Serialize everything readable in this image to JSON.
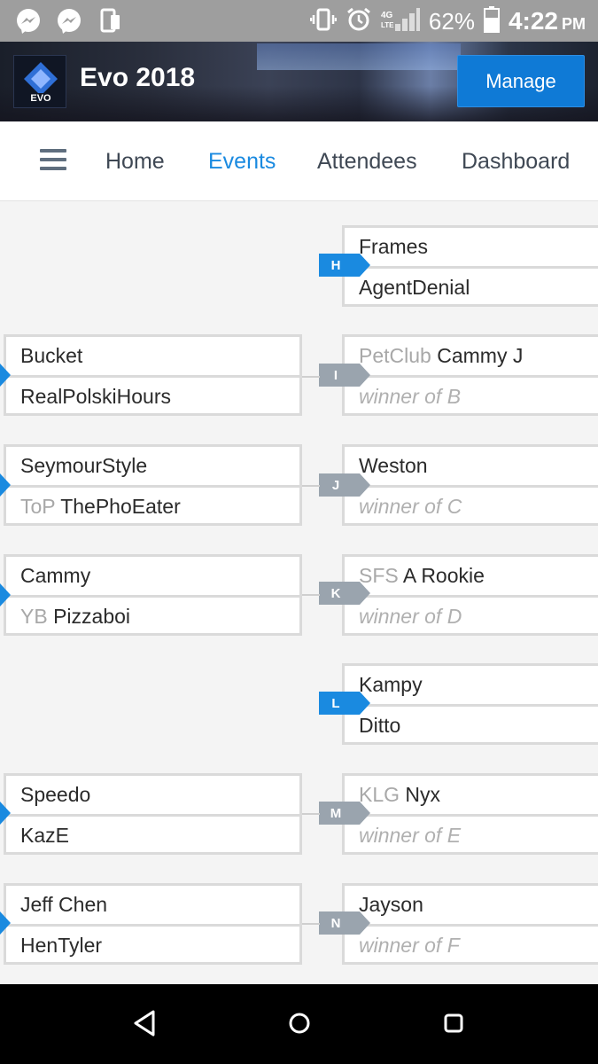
{
  "status_bar": {
    "battery": "62%",
    "time": "4:22",
    "ampm": "PM",
    "network": "4G LTE"
  },
  "header": {
    "logo_text": "EVO",
    "title": "Evo 2018",
    "manage_label": "Manage"
  },
  "nav": {
    "items": [
      "Home",
      "Events",
      "Attendees",
      "Dashboard"
    ],
    "active": "Events"
  },
  "bracket": {
    "left_matches": [
      {
        "top": {
          "prefix": "",
          "name": "Bucket"
        },
        "bottom": {
          "prefix": "",
          "name": "RealPolskiHours"
        }
      },
      {
        "top": {
          "prefix": "",
          "name": "SeymourStyle"
        },
        "bottom": {
          "prefix": "ToP",
          "name": "ThePhoEater"
        }
      },
      {
        "top": {
          "prefix": "",
          "name": "Cammy"
        },
        "bottom": {
          "prefix": "YB",
          "name": "Pizzaboi"
        }
      },
      {
        "top": {
          "prefix": "",
          "name": "Speedo"
        },
        "bottom": {
          "prefix": "",
          "name": "KazE"
        }
      },
      {
        "top": {
          "prefix": "",
          "name": "Jeff Chen"
        },
        "bottom": {
          "prefix": "",
          "name": "HenTyler"
        }
      }
    ],
    "right_matches": [
      {
        "id": "H",
        "status": "blue",
        "top": {
          "prefix": "",
          "name": "Frames"
        },
        "bottom": {
          "prefix": "",
          "name": "AgentDenial"
        }
      },
      {
        "id": "I",
        "status": "gray",
        "top": {
          "prefix": "PetClub",
          "name": "Cammy J"
        },
        "bottom": {
          "pending": "winner of B"
        }
      },
      {
        "id": "J",
        "status": "gray",
        "top": {
          "prefix": "",
          "name": "Weston"
        },
        "bottom": {
          "pending": "winner of C"
        }
      },
      {
        "id": "K",
        "status": "gray",
        "top": {
          "prefix": "SFS",
          "name": "A Rookie"
        },
        "bottom": {
          "pending": "winner of D"
        }
      },
      {
        "id": "L",
        "status": "blue",
        "top": {
          "prefix": "",
          "name": "Kampy"
        },
        "bottom": {
          "prefix": "",
          "name": "Ditto"
        }
      },
      {
        "id": "M",
        "status": "gray",
        "top": {
          "prefix": "KLG",
          "name": "Nyx"
        },
        "bottom": {
          "pending": "winner of E"
        }
      },
      {
        "id": "N",
        "status": "gray",
        "top": {
          "prefix": "",
          "name": "Jayson"
        },
        "bottom": {
          "pending": "winner of F"
        }
      }
    ]
  },
  "colors": {
    "accent": "#1a8ae0",
    "manage_button": "#0f7ad6",
    "tag_gray": "#9aa4ae",
    "status_bar": "#9e9e9e"
  },
  "icons": {
    "status_left": [
      "messenger-icon",
      "messenger-icon",
      "phone-sync-icon"
    ],
    "status_right": [
      "vibrate-icon",
      "alarm-icon",
      "signal-icon",
      "battery-icon"
    ],
    "android_nav": [
      "back-icon",
      "home-icon",
      "recents-icon"
    ]
  }
}
